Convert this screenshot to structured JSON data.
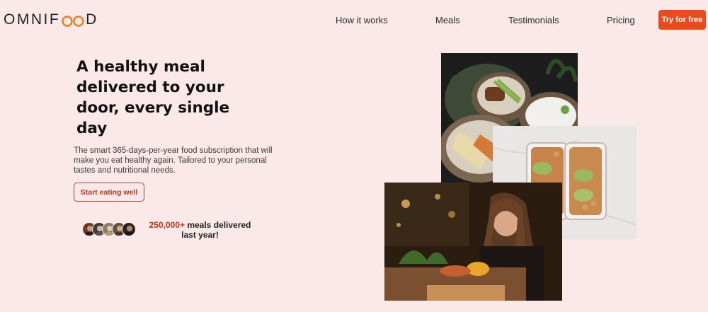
{
  "header": {
    "logo_text_left": "OMNIF",
    "logo_text_right": "D",
    "nav": [
      "How it works",
      "Meals",
      "Testimonials",
      "Pricing"
    ],
    "cta_label": "Try for free"
  },
  "hero": {
    "title": "A healthy meal delivered to your door, every single day",
    "description": "The smart 365-days-per-year food subscription that will make you eat healthy again. Tailored to your personal tastes and nutritional needs.",
    "button_label": "Start eating well",
    "stats_number": "250,000+",
    "stats_text": " meals delivered last year!"
  },
  "colors": {
    "accent": "#ea4a1c",
    "background": "#fae9e8",
    "logo_infinity": "#e67e22"
  },
  "images": [
    {
      "name": "bowls-photo",
      "description_icon": "food-bowls"
    },
    {
      "name": "meal-prep-photo",
      "description_icon": "meal-prep-boxes"
    },
    {
      "name": "woman-eating-photo",
      "description_icon": "woman-restaurant"
    }
  ],
  "avatar_count": 5
}
